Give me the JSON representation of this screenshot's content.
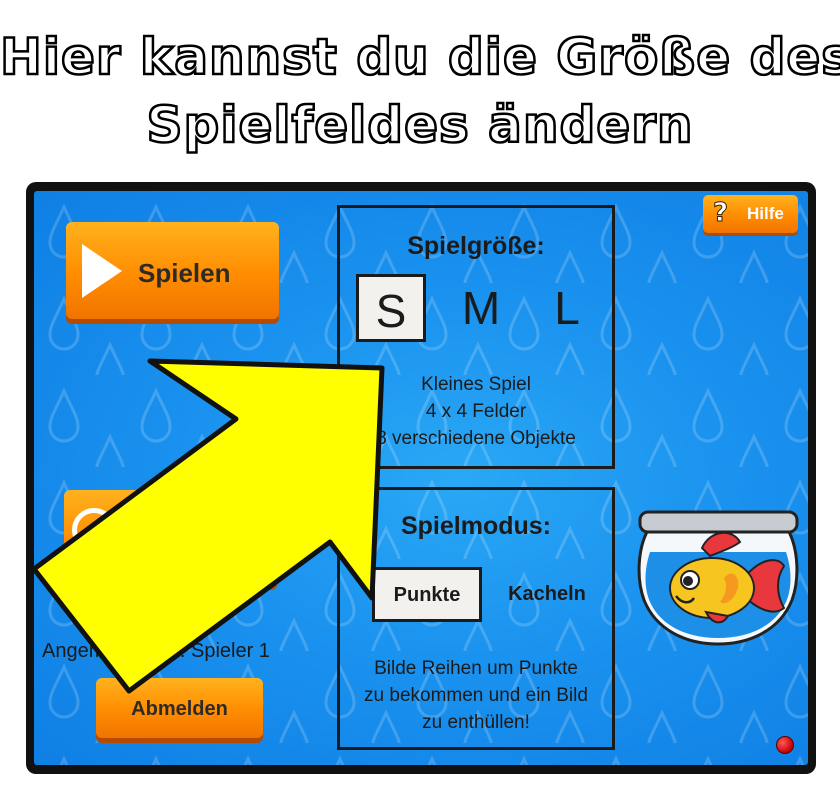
{
  "headline": {
    "line1": "Hier kannst du die Größe des",
    "line2": "Spielfeldes ändern"
  },
  "left": {
    "play_label": "Spielen",
    "logged_in_text": "Angemeldet als: Spieler 1",
    "logout_label": "Abmelden"
  },
  "help": {
    "icon": "?",
    "label": "Hilfe"
  },
  "size_panel": {
    "title": "Spielgröße:",
    "options": [
      "S",
      "M",
      "L"
    ],
    "selected": "S",
    "desc_line1": "Kleines Spiel",
    "desc_line2": "4 x 4 Felder",
    "desc_line3": "8 verschiedene Objekte"
  },
  "mode_panel": {
    "title": "Spielmodus:",
    "options": [
      "Punkte",
      "Kacheln"
    ],
    "selected": "Punkte",
    "desc_line1": "Bilde Reihen um Punkte",
    "desc_line2": "zu bekommen und ein Bild",
    "desc_line3": "zu enthüllen!"
  },
  "colors": {
    "background_blue": "#1a92ef",
    "button_orange": "#ff8c00",
    "arrow_yellow": "#ffff00",
    "panel_border": "#1b1b1b"
  },
  "icons": {
    "play": "play-triangle-icon",
    "help": "question-mark-icon",
    "fishbowl": "goldfish-bowl-icon",
    "indicator": "red-status-dot-icon",
    "overlay": "yellow-arrow-icon"
  }
}
